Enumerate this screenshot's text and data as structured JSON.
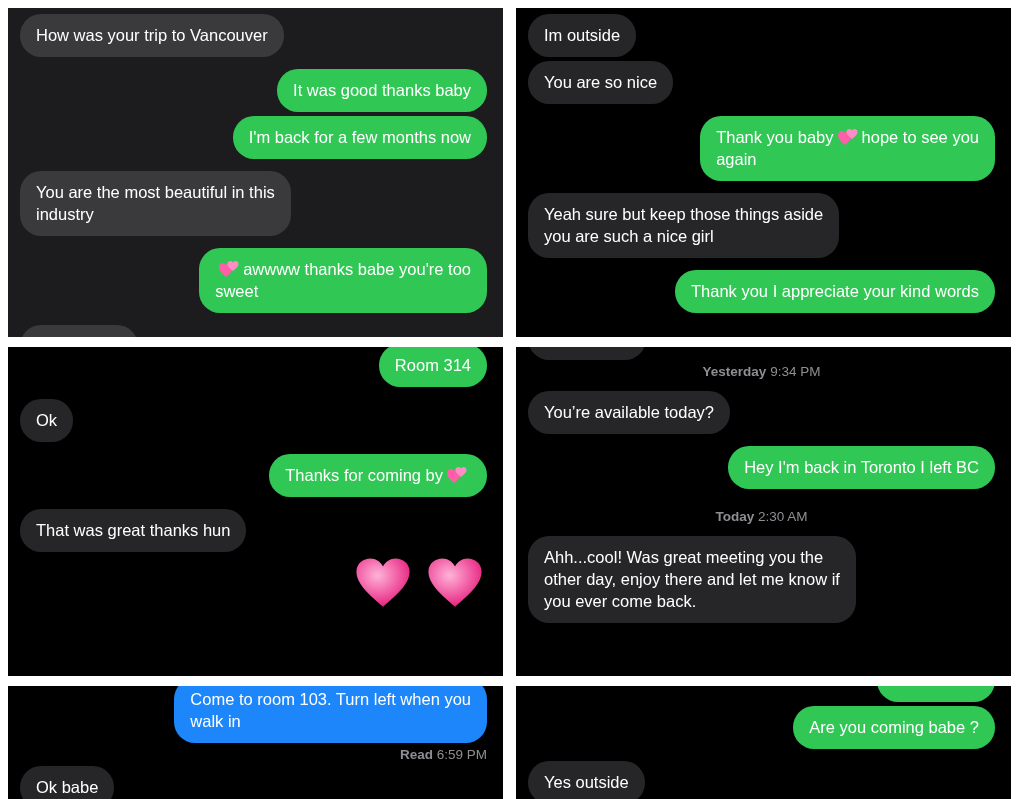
{
  "panels": [
    {
      "kind": "dark_grey",
      "messages": [
        {
          "kind": "received",
          "lines": [
            "How was your trip to Vancouver"
          ]
        },
        {
          "kind": "sent",
          "lines": [
            "It was good thanks baby"
          ]
        },
        {
          "kind": "sent",
          "lines": [
            "I'm back for a few months now"
          ]
        },
        {
          "kind": "received",
          "lines": [
            "You are the most beautiful in this",
            "industry"
          ]
        },
        {
          "kind": "sent",
          "lines": [
            [
              {
                "kind": "hearts"
              },
              {
                "kind": "text",
                "text": "awwww thanks babe you're too"
              }
            ],
            "sweet"
          ]
        },
        {
          "kind": "partial_received"
        }
      ]
    },
    {
      "kind": "black",
      "messages": [
        {
          "kind": "received",
          "lines": [
            "Im outside"
          ]
        },
        {
          "kind": "received",
          "lines": [
            "You are so nice"
          ]
        },
        {
          "kind": "sent",
          "lines": [
            [
              {
                "kind": "text",
                "text": "Thank you baby"
              },
              {
                "kind": "hearts"
              },
              {
                "kind": "text",
                "text": "hope to see you"
              }
            ],
            "again"
          ]
        },
        {
          "kind": "received",
          "lines": [
            "Yeah sure but keep those things aside",
            "you are such a nice girl"
          ]
        },
        {
          "kind": "sent",
          "lines": [
            "Thank you I appreciate your kind words"
          ]
        }
      ]
    },
    {
      "kind": "black",
      "messages": [
        {
          "kind": "sent",
          "lines": [
            "Room 314"
          ]
        },
        {
          "kind": "received",
          "lines": [
            "Ok"
          ]
        },
        {
          "kind": "sent",
          "lines": [
            [
              {
                "kind": "text",
                "text": "Thanks for coming by"
              },
              {
                "kind": "hearts"
              }
            ]
          ]
        },
        {
          "kind": "received",
          "lines": [
            "That was great thanks hun"
          ]
        },
        {
          "kind": "big_hearts",
          "items": [
            {
              "kind": "heart"
            },
            {
              "kind": "heart"
            }
          ]
        }
      ]
    },
    {
      "kind": "black",
      "messages": [
        {
          "kind": "partial_received"
        },
        {
          "kind": "timestamp",
          "text": "**Yesterday** 9:34 PM"
        },
        {
          "kind": "received",
          "lines": [
            "You’re available today?"
          ]
        },
        {
          "kind": "sent",
          "lines": [
            "Hey I'm back in Toronto I left BC"
          ]
        },
        {
          "kind": "timestamp",
          "text": "**Today** 2:30 AM"
        },
        {
          "kind": "received",
          "lines": [
            "Ahh...cool! Was great meeting you the",
            "other day, enjoy there and let me know if",
            "you ever come back."
          ]
        }
      ]
    },
    {
      "kind": "black",
      "messages": [
        {
          "kind": "sent_blue",
          "lines": [
            "Come to room 103. Turn left when you",
            "walk in"
          ]
        },
        {
          "kind": "receipt",
          "text": "**Read** 6:59 PM"
        },
        {
          "kind": "received",
          "lines": [
            "Ok babe"
          ]
        }
      ]
    },
    {
      "kind": "black",
      "messages": [
        {
          "kind": "partial_sent"
        },
        {
          "kind": "sent",
          "lines": [
            "Are you coming babe ?"
          ]
        },
        {
          "kind": "received",
          "lines": [
            "Yes outside"
          ]
        }
      ]
    }
  ]
}
